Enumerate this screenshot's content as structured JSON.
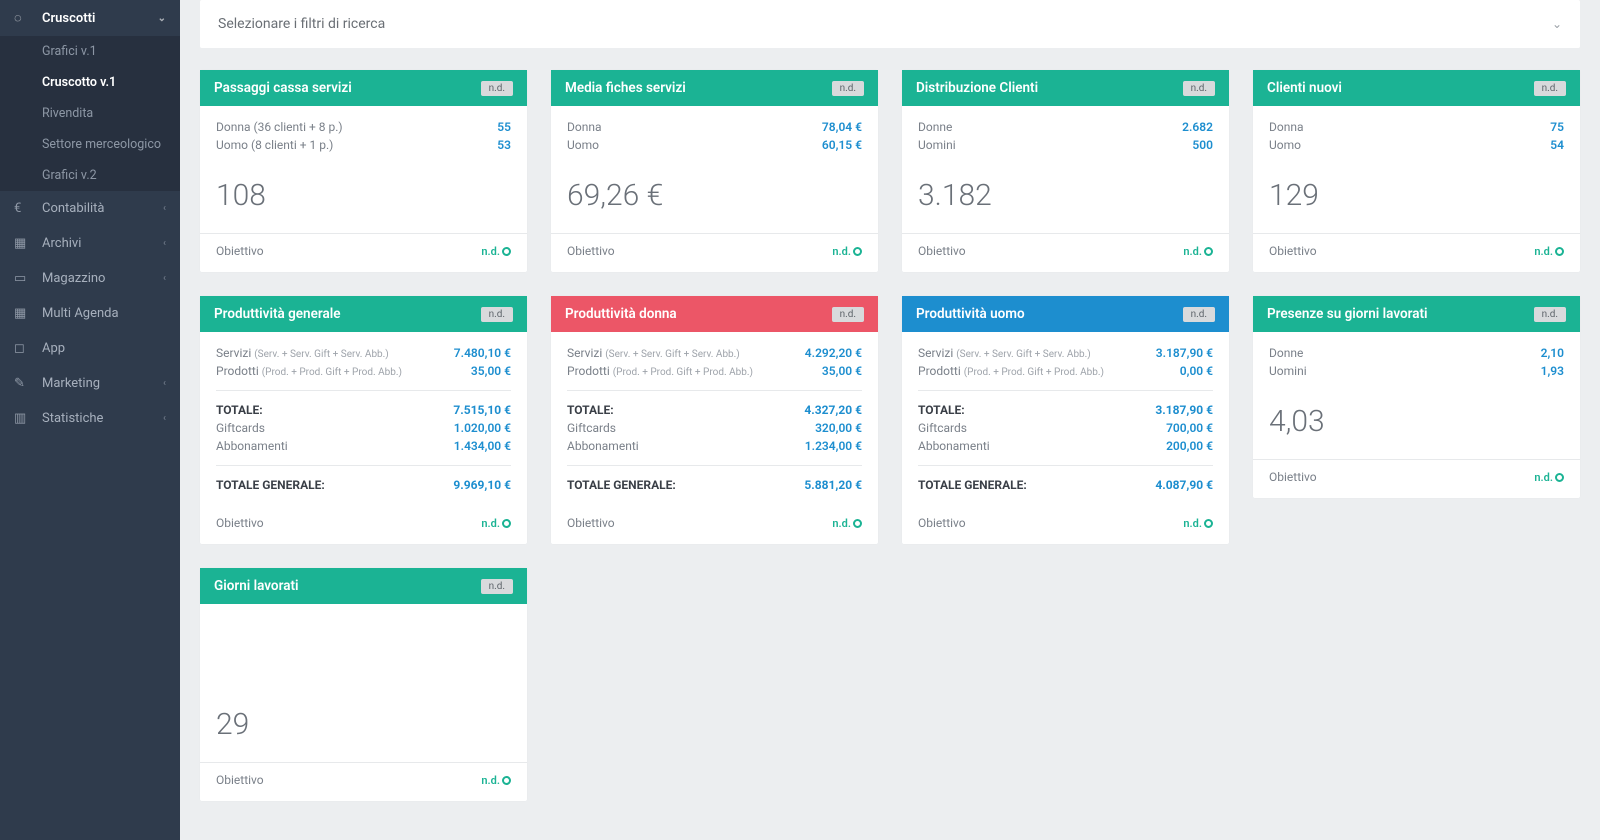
{
  "sidebar": {
    "top": {
      "label": "Cruscotti"
    },
    "sub": [
      {
        "label": "Grafici v.1"
      },
      {
        "label": "Cruscotto v.1",
        "active": true
      },
      {
        "label": "Rivendita"
      },
      {
        "label": "Settore merceologico"
      },
      {
        "label": "Grafici v.2"
      }
    ],
    "items": [
      {
        "label": "Contabilità",
        "chev": true
      },
      {
        "label": "Archivi",
        "chev": true
      },
      {
        "label": "Magazzino",
        "chev": true
      },
      {
        "label": "Multi Agenda",
        "chev": false
      },
      {
        "label": "App",
        "chev": false
      },
      {
        "label": "Marketing",
        "chev": true
      },
      {
        "label": "Statistiche",
        "chev": true
      }
    ]
  },
  "filter": {
    "label": "Selezionare i filtri di ricerca"
  },
  "badge_nd": "n.d.",
  "foot_obiettivo": "Obiettivo",
  "foot_nd": "n.d.",
  "cards": {
    "passaggi": {
      "title": "Passaggi cassa servizi",
      "rows": [
        [
          "Donna (36 clienti + 8 p.)",
          "55"
        ],
        [
          "Uomo (8 clienti + 1 p.)",
          "53"
        ]
      ],
      "big": "108"
    },
    "media": {
      "title": "Media fiches servizi",
      "rows": [
        [
          "Donna",
          "78,04 €"
        ],
        [
          "Uomo",
          "60,15 €"
        ]
      ],
      "big": "69,26 €"
    },
    "dist": {
      "title": "Distribuzione Clienti",
      "rows": [
        [
          "Donne",
          "2.682"
        ],
        [
          "Uomini",
          "500"
        ]
      ],
      "big": "3.182"
    },
    "nuovi": {
      "title": "Clienti nuovi",
      "rows": [
        [
          "Donna",
          "75"
        ],
        [
          "Uomo",
          "54"
        ]
      ],
      "big": "129"
    },
    "prodgen": {
      "title": "Produttività generale",
      "r_serv": [
        "Servizi",
        "(Serv. + Serv. Gift + Serv. Abb.)",
        "7.480,10 €"
      ],
      "r_prod": [
        "Prodotti",
        "(Prod. + Prod. Gift + Prod. Abb.)",
        "35,00 €"
      ],
      "r_tot": [
        "TOTALE:",
        "7.515,10 €"
      ],
      "r_gift": [
        "Giftcards",
        "1.020,00 €"
      ],
      "r_abb": [
        "Abbonamenti",
        "1.434,00 €"
      ],
      "r_gen": [
        "TOTALE GENERALE:",
        "9.969,10 €"
      ]
    },
    "proddonna": {
      "title": "Produttività donna",
      "r_serv": [
        "Servizi",
        "(Serv. + Serv. Gift + Serv. Abb.)",
        "4.292,20 €"
      ],
      "r_prod": [
        "Prodotti",
        "(Prod. + Prod. Gift + Prod. Abb.)",
        "35,00 €"
      ],
      "r_tot": [
        "TOTALE:",
        "4.327,20 €"
      ],
      "r_gift": [
        "Giftcards",
        "320,00 €"
      ],
      "r_abb": [
        "Abbonamenti",
        "1.234,00 €"
      ],
      "r_gen": [
        "TOTALE GENERALE:",
        "5.881,20 €"
      ]
    },
    "produomo": {
      "title": "Produttività uomo",
      "r_serv": [
        "Servizi",
        "(Serv. + Serv. Gift + Serv. Abb.)",
        "3.187,90 €"
      ],
      "r_prod": [
        "Prodotti",
        "(Prod. + Prod. Gift + Prod. Abb.)",
        "0,00 €"
      ],
      "r_tot": [
        "TOTALE:",
        "3.187,90 €"
      ],
      "r_gift": [
        "Giftcards",
        "700,00 €"
      ],
      "r_abb": [
        "Abbonamenti",
        "200,00 €"
      ],
      "r_gen": [
        "TOTALE GENERALE:",
        "4.087,90 €"
      ]
    },
    "presenze": {
      "title": "Presenze su giorni lavorati",
      "rows": [
        [
          "Donne",
          "2,10"
        ],
        [
          "Uomini",
          "1,93"
        ]
      ],
      "big": "4,03"
    },
    "giorni": {
      "title": "Giorni lavorati",
      "big": "29"
    }
  }
}
